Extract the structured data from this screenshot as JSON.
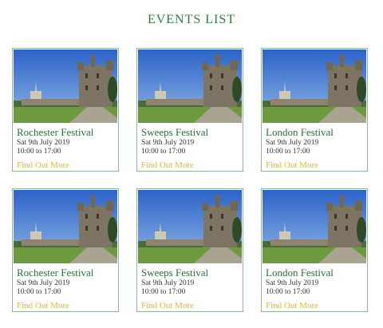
{
  "page": {
    "title": "EVENTS LIST"
  },
  "events": [
    {
      "name": "Rochester Festival",
      "date": "Sat 9th July 2019",
      "time": "10:00 to 17:00",
      "link": "Find Out More"
    },
    {
      "name": "Sweeps Festival",
      "date": "Sat 9th July 2019",
      "time": "10:00 to 17:00",
      "link": "Find Out More"
    },
    {
      "name": "London Festival",
      "date": "Sat 9th July 2019",
      "time": "10:00 to 17:00",
      "link": "Find Out More"
    },
    {
      "name": "Rochester Festival",
      "date": "Sat 9th July 2019",
      "time": "10:00 to 17:00",
      "link": "Find Out More"
    },
    {
      "name": "Sweeps Festival",
      "date": "Sat 9th July 2019",
      "time": "10:00 to 17:00",
      "link": "Find Out More"
    },
    {
      "name": "London Festival",
      "date": "Sat 9th July 2019",
      "time": "10:00 to 17:00",
      "link": "Find Out More"
    }
  ],
  "colors": {
    "title": "#2f7a3f",
    "event_name": "#2c6e3b",
    "link": "#e6b72b",
    "card_border": "#8fb79a"
  }
}
